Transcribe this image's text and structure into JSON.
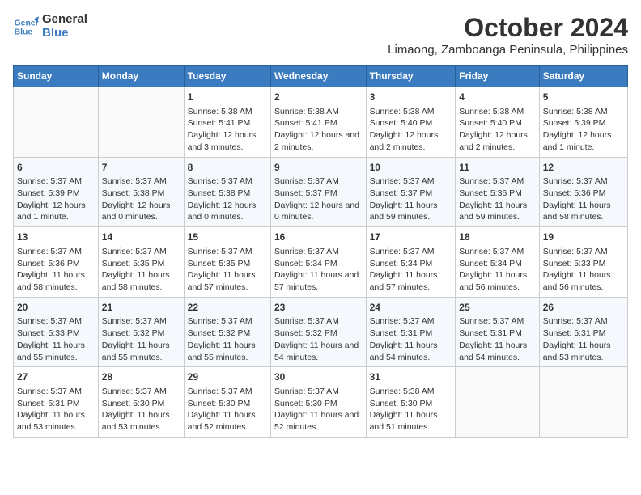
{
  "logo": {
    "line1": "General",
    "line2": "Blue"
  },
  "title": "October 2024",
  "location": "Limaong, Zamboanga Peninsula, Philippines",
  "days_of_week": [
    "Sunday",
    "Monday",
    "Tuesday",
    "Wednesday",
    "Thursday",
    "Friday",
    "Saturday"
  ],
  "weeks": [
    [
      {
        "day": "",
        "content": ""
      },
      {
        "day": "",
        "content": ""
      },
      {
        "day": "1",
        "content": "Sunrise: 5:38 AM\nSunset: 5:41 PM\nDaylight: 12 hours and 3 minutes."
      },
      {
        "day": "2",
        "content": "Sunrise: 5:38 AM\nSunset: 5:41 PM\nDaylight: 12 hours and 2 minutes."
      },
      {
        "day": "3",
        "content": "Sunrise: 5:38 AM\nSunset: 5:40 PM\nDaylight: 12 hours and 2 minutes."
      },
      {
        "day": "4",
        "content": "Sunrise: 5:38 AM\nSunset: 5:40 PM\nDaylight: 12 hours and 2 minutes."
      },
      {
        "day": "5",
        "content": "Sunrise: 5:38 AM\nSunset: 5:39 PM\nDaylight: 12 hours and 1 minute."
      }
    ],
    [
      {
        "day": "6",
        "content": "Sunrise: 5:37 AM\nSunset: 5:39 PM\nDaylight: 12 hours and 1 minute."
      },
      {
        "day": "7",
        "content": "Sunrise: 5:37 AM\nSunset: 5:38 PM\nDaylight: 12 hours and 0 minutes."
      },
      {
        "day": "8",
        "content": "Sunrise: 5:37 AM\nSunset: 5:38 PM\nDaylight: 12 hours and 0 minutes."
      },
      {
        "day": "9",
        "content": "Sunrise: 5:37 AM\nSunset: 5:37 PM\nDaylight: 12 hours and 0 minutes."
      },
      {
        "day": "10",
        "content": "Sunrise: 5:37 AM\nSunset: 5:37 PM\nDaylight: 11 hours and 59 minutes."
      },
      {
        "day": "11",
        "content": "Sunrise: 5:37 AM\nSunset: 5:36 PM\nDaylight: 11 hours and 59 minutes."
      },
      {
        "day": "12",
        "content": "Sunrise: 5:37 AM\nSunset: 5:36 PM\nDaylight: 11 hours and 58 minutes."
      }
    ],
    [
      {
        "day": "13",
        "content": "Sunrise: 5:37 AM\nSunset: 5:36 PM\nDaylight: 11 hours and 58 minutes."
      },
      {
        "day": "14",
        "content": "Sunrise: 5:37 AM\nSunset: 5:35 PM\nDaylight: 11 hours and 58 minutes."
      },
      {
        "day": "15",
        "content": "Sunrise: 5:37 AM\nSunset: 5:35 PM\nDaylight: 11 hours and 57 minutes."
      },
      {
        "day": "16",
        "content": "Sunrise: 5:37 AM\nSunset: 5:34 PM\nDaylight: 11 hours and 57 minutes."
      },
      {
        "day": "17",
        "content": "Sunrise: 5:37 AM\nSunset: 5:34 PM\nDaylight: 11 hours and 57 minutes."
      },
      {
        "day": "18",
        "content": "Sunrise: 5:37 AM\nSunset: 5:34 PM\nDaylight: 11 hours and 56 minutes."
      },
      {
        "day": "19",
        "content": "Sunrise: 5:37 AM\nSunset: 5:33 PM\nDaylight: 11 hours and 56 minutes."
      }
    ],
    [
      {
        "day": "20",
        "content": "Sunrise: 5:37 AM\nSunset: 5:33 PM\nDaylight: 11 hours and 55 minutes."
      },
      {
        "day": "21",
        "content": "Sunrise: 5:37 AM\nSunset: 5:32 PM\nDaylight: 11 hours and 55 minutes."
      },
      {
        "day": "22",
        "content": "Sunrise: 5:37 AM\nSunset: 5:32 PM\nDaylight: 11 hours and 55 minutes."
      },
      {
        "day": "23",
        "content": "Sunrise: 5:37 AM\nSunset: 5:32 PM\nDaylight: 11 hours and 54 minutes."
      },
      {
        "day": "24",
        "content": "Sunrise: 5:37 AM\nSunset: 5:31 PM\nDaylight: 11 hours and 54 minutes."
      },
      {
        "day": "25",
        "content": "Sunrise: 5:37 AM\nSunset: 5:31 PM\nDaylight: 11 hours and 54 minutes."
      },
      {
        "day": "26",
        "content": "Sunrise: 5:37 AM\nSunset: 5:31 PM\nDaylight: 11 hours and 53 minutes."
      }
    ],
    [
      {
        "day": "27",
        "content": "Sunrise: 5:37 AM\nSunset: 5:31 PM\nDaylight: 11 hours and 53 minutes."
      },
      {
        "day": "28",
        "content": "Sunrise: 5:37 AM\nSunset: 5:30 PM\nDaylight: 11 hours and 53 minutes."
      },
      {
        "day": "29",
        "content": "Sunrise: 5:37 AM\nSunset: 5:30 PM\nDaylight: 11 hours and 52 minutes."
      },
      {
        "day": "30",
        "content": "Sunrise: 5:37 AM\nSunset: 5:30 PM\nDaylight: 11 hours and 52 minutes."
      },
      {
        "day": "31",
        "content": "Sunrise: 5:38 AM\nSunset: 5:30 PM\nDaylight: 11 hours and 51 minutes."
      },
      {
        "day": "",
        "content": ""
      },
      {
        "day": "",
        "content": ""
      }
    ]
  ]
}
